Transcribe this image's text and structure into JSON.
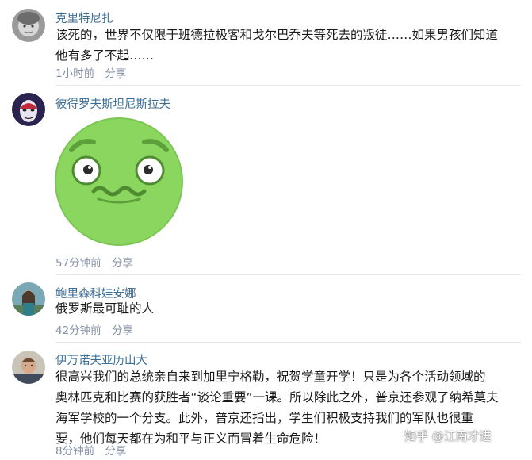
{
  "comments": [
    {
      "author": "克里特尼扎",
      "lines": [
        "该死的，世界不仅限于班德拉极客和戈尔巴乔夫等死去的叛徒……如果男孩们知道",
        "他有多了不起……"
      ],
      "time": "1小时前",
      "share": "分享"
    },
    {
      "author": "彼得罗夫斯坦尼斯拉夫",
      "sticker": "nauseated-face-sticker",
      "time": "57分钟前",
      "share": "分享"
    },
    {
      "author": "鲍里森科娃安娜",
      "lines": [
        "俄罗斯最可耻的人"
      ],
      "time": "42分钟前",
      "share": "分享"
    },
    {
      "author": "伊万诺夫亚历山大",
      "lines": [
        "很高兴我们的总统亲自来到加里宁格勒，祝贺学童开学！只是为各个活动领域的",
        "奥林匹克和比赛的获胜者“谈论重要”一课。所以除此之外，普京还参观了纳希莫夫",
        "海军学校的一个分支。此外，普京还指出，学生们积极支持我们的军队也很重",
        "要，他们每天都在为和平与正义而冒着生命危险！"
      ],
      "time": "8分钟前",
      "share": "分享"
    }
  ],
  "watermark": "知乎 @江南才进",
  "colors": {
    "author": "#3b6e96",
    "meta": "#8590a6",
    "text": "#1a1a1a",
    "divider": "#e6e6e6",
    "sticker_green": "#8ad65e"
  }
}
